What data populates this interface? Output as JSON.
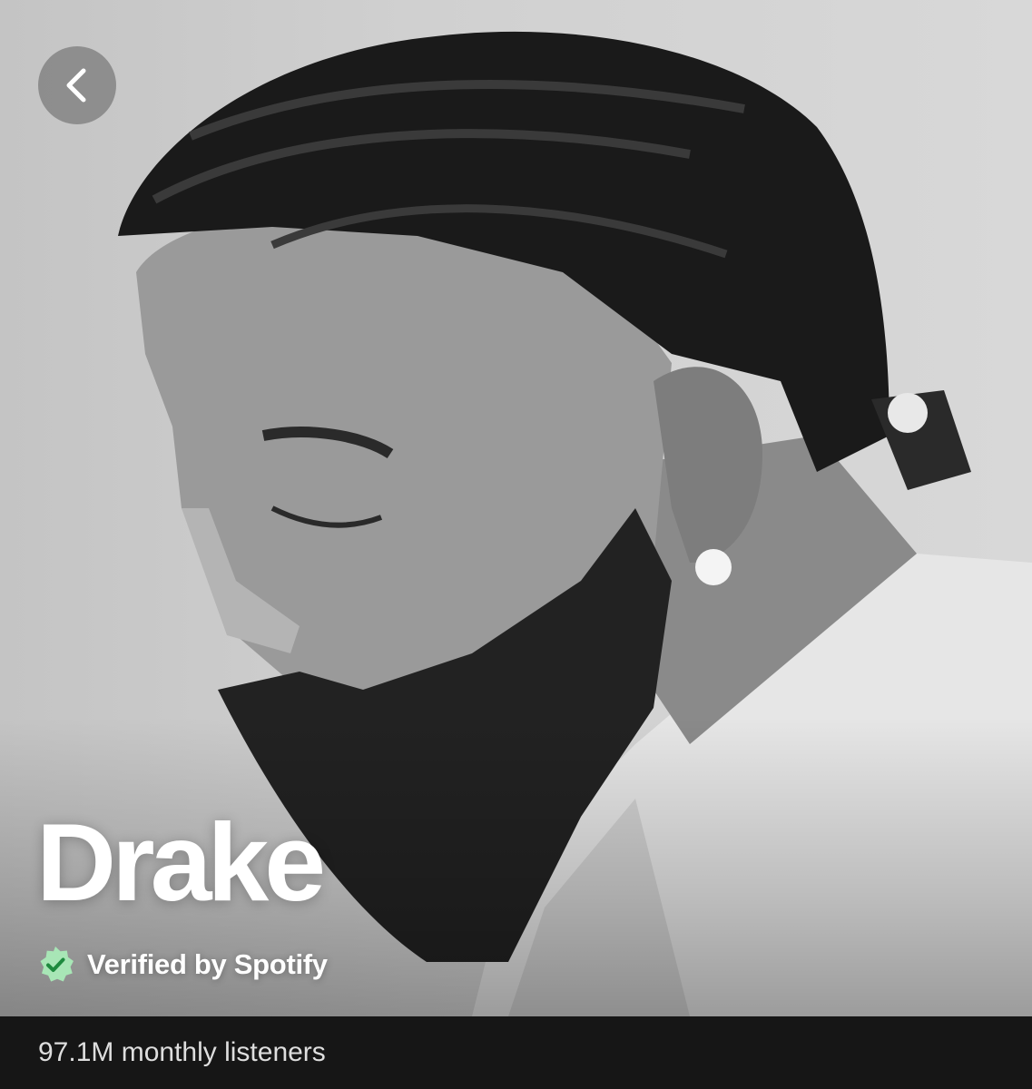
{
  "artist": {
    "name": "Drake",
    "verified_label": "Verified by Spotify",
    "monthly_listeners": "97.1M monthly listeners"
  },
  "icons": {
    "back": "chevron-left-icon",
    "verified": "verified-badge-icon"
  },
  "colors": {
    "verified_badge": "#a8e6b6",
    "verified_check": "#1e8a3e",
    "listeners_bar": "#161616",
    "text_primary": "#ffffff"
  }
}
